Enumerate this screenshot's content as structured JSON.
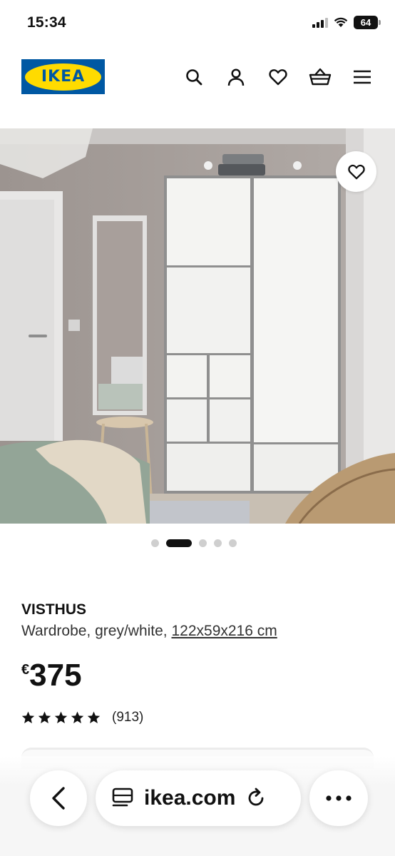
{
  "status_bar": {
    "time": "15:34",
    "battery": "64",
    "icons": [
      "cellular-signal-icon",
      "wifi-icon",
      "battery-icon"
    ]
  },
  "header": {
    "logo_text": "IKEA",
    "icons": [
      "search-icon",
      "account-icon",
      "heart-icon",
      "basket-icon",
      "menu-icon"
    ],
    "brand_colors": {
      "blue": "#0058a3",
      "yellow": "#ffdb00"
    }
  },
  "gallery": {
    "favorite_icon": "heart-icon",
    "image_count": 5,
    "active_index": 1
  },
  "product": {
    "name": "VISTHUS",
    "description": "Wardrobe, grey/white,",
    "dimensions": "122x59x216 cm",
    "currency": "€",
    "price": "375",
    "rating_stars": 5,
    "rating_count": "(913)"
  },
  "browser": {
    "back_icon": "back-chevron-icon",
    "tab_icon": "reader-icon",
    "url": "ikea.com",
    "reload_icon": "reload-icon",
    "more_icon": "more-icon"
  }
}
